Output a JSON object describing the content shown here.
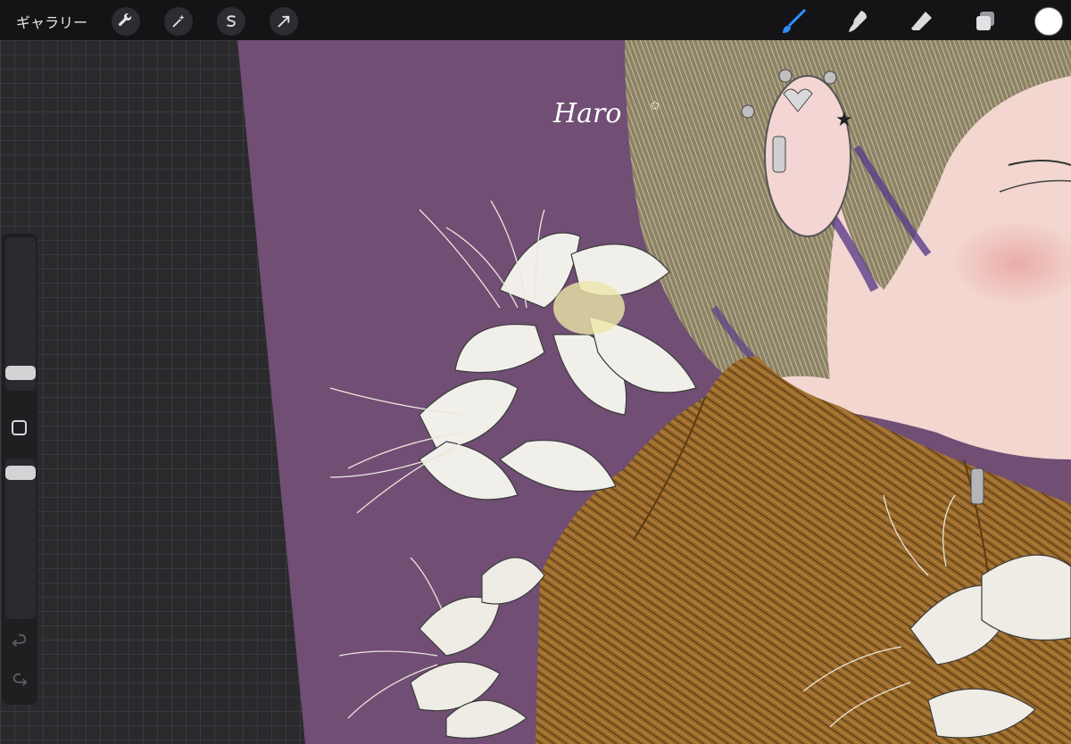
{
  "toolbar": {
    "gallery_label": "ギャラリー",
    "left_tools": [
      {
        "icon": "wrench-icon",
        "name": "actions-button"
      },
      {
        "icon": "magic-wand-icon",
        "name": "adjustments-button"
      },
      {
        "icon": "selection-icon",
        "name": "selection-button"
      },
      {
        "icon": "arrow-icon",
        "name": "transform-button"
      }
    ],
    "right_tools": [
      {
        "icon": "brush-icon",
        "name": "brush-tool",
        "active": true,
        "accent": "#2f8fff"
      },
      {
        "icon": "smudge-icon",
        "name": "smudge-tool"
      },
      {
        "icon": "eraser-icon",
        "name": "eraser-tool"
      },
      {
        "icon": "layers-icon",
        "name": "layers-button"
      }
    ],
    "current_color": "#ffffff"
  },
  "sidebar": {
    "brush_size_icon": "size-slider",
    "opacity_icon": "opacity-slider",
    "modify_icon": "modify-square-icon",
    "undo_icon": "undo-icon",
    "redo_icon": "redo-icon"
  },
  "canvas": {
    "signature": "Haro",
    "background_color": "#6c4a6e"
  }
}
